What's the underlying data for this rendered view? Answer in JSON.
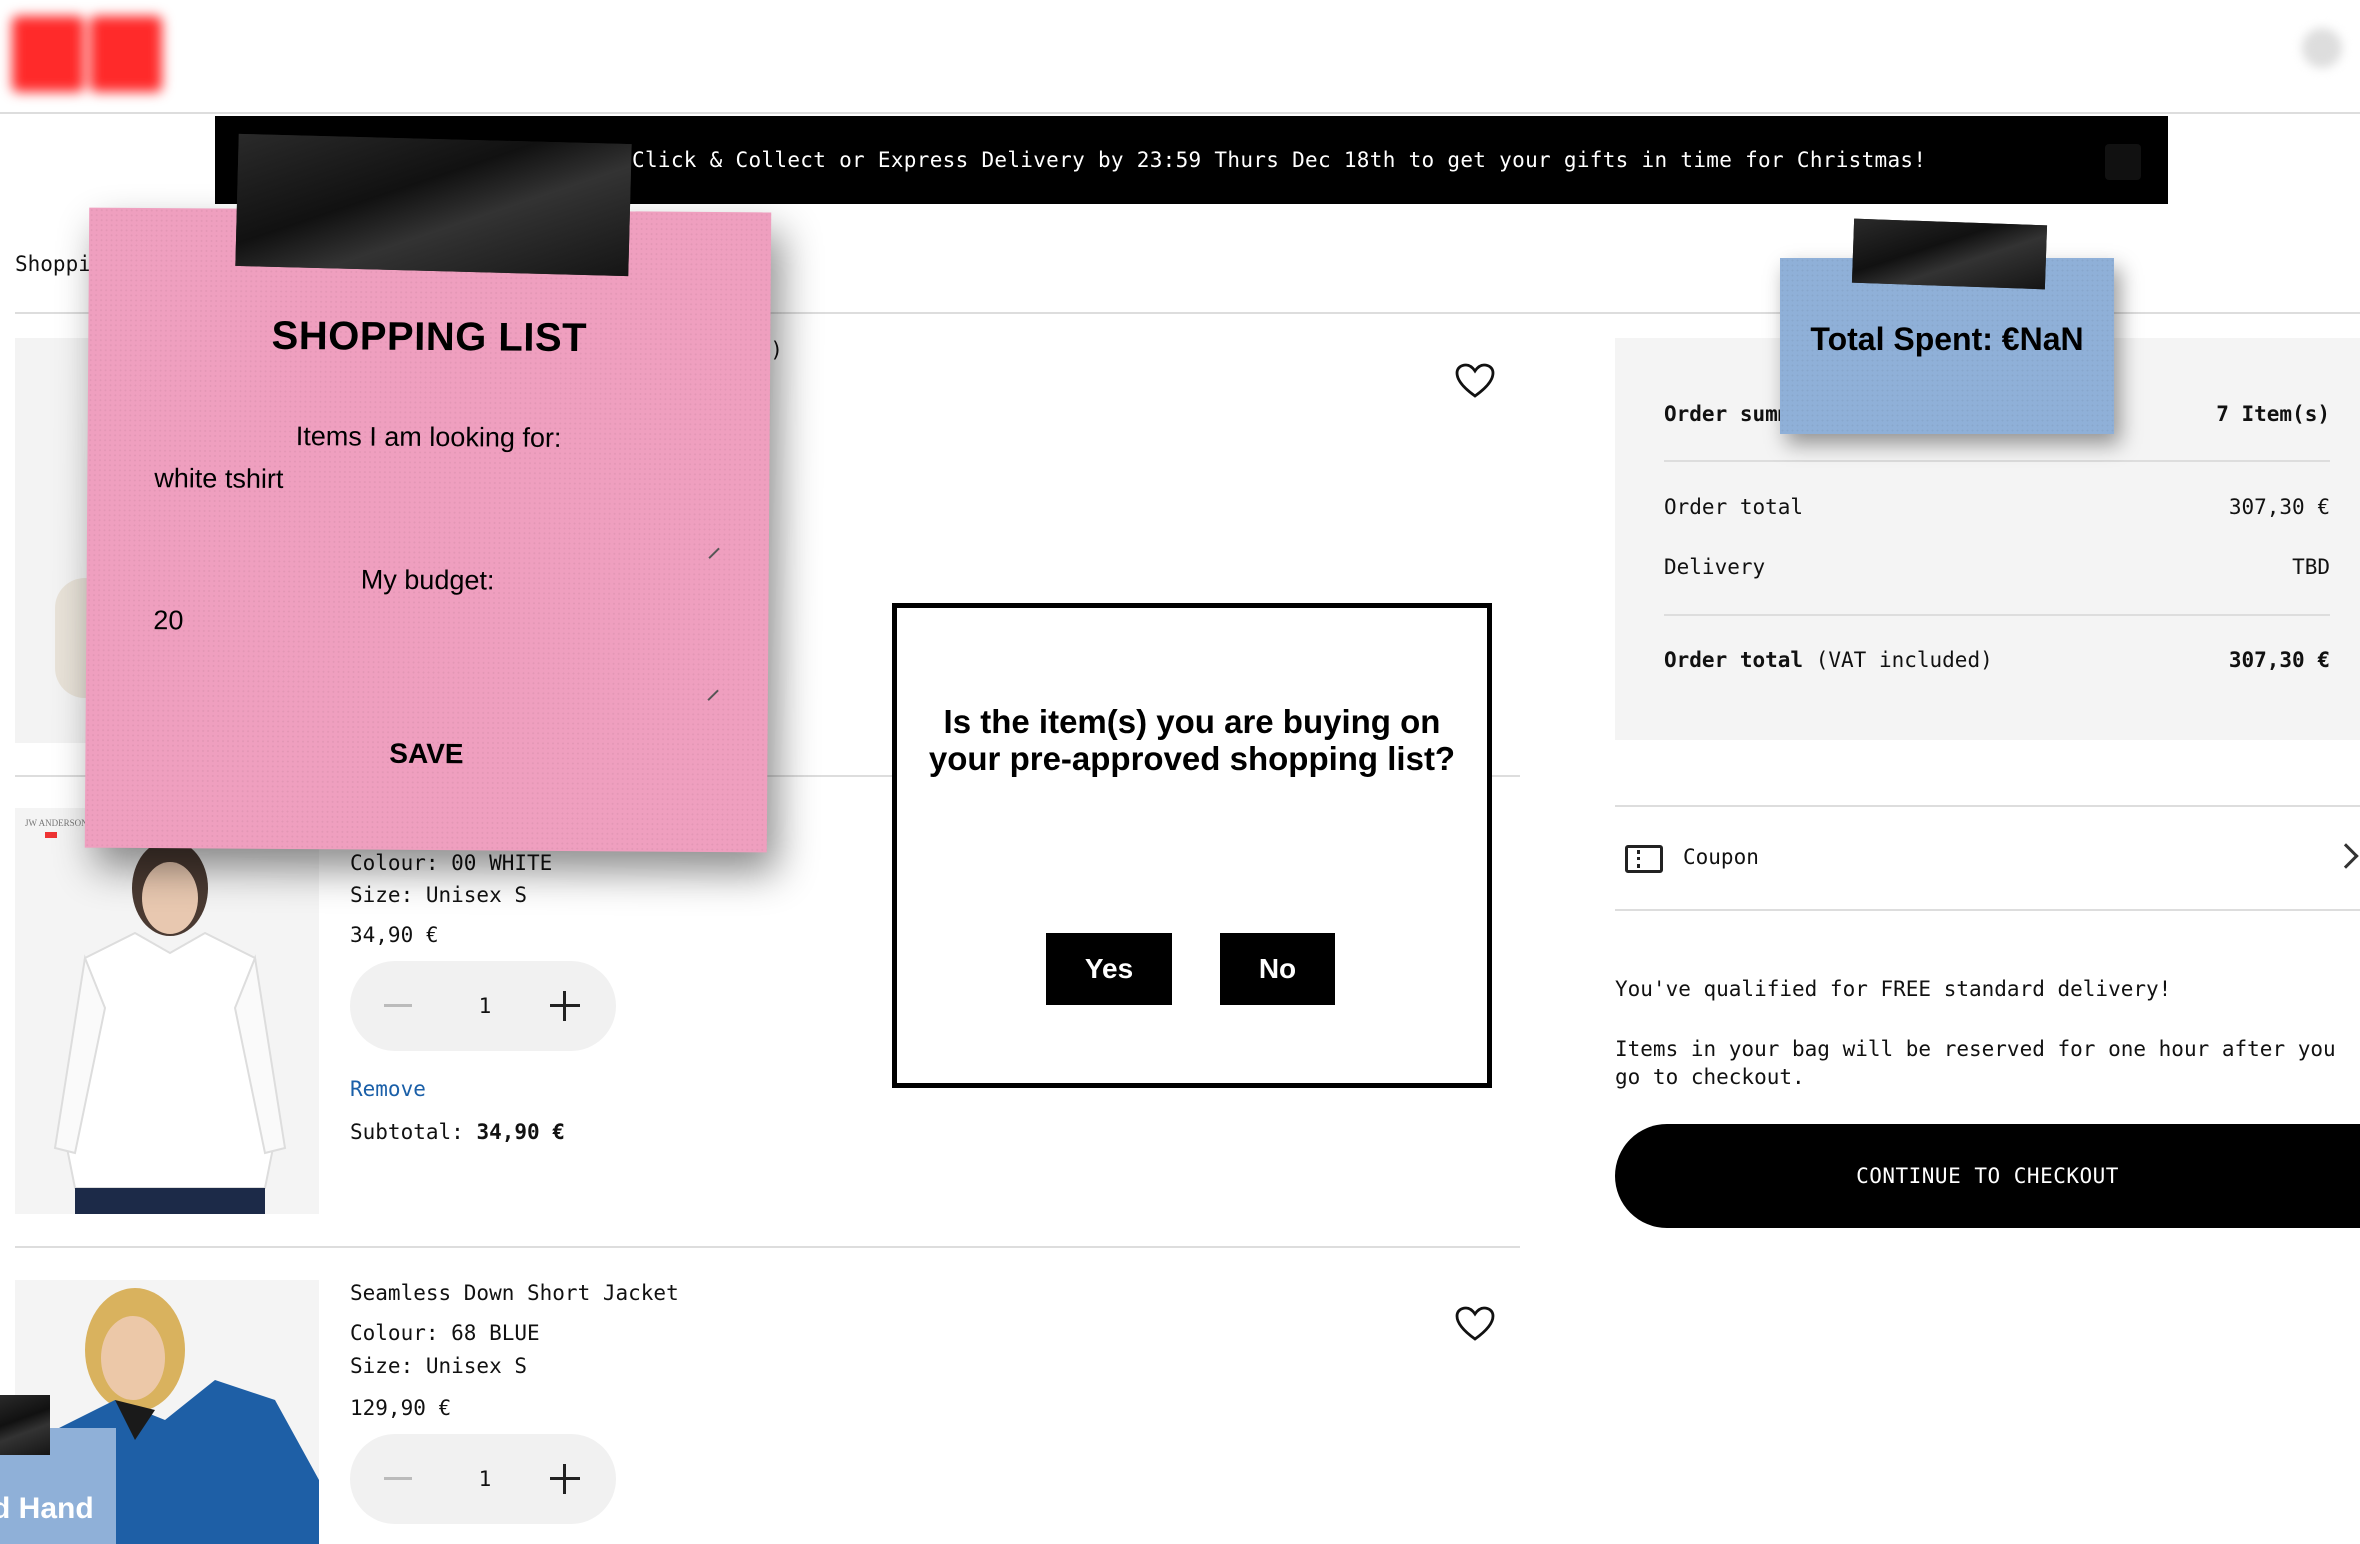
{
  "header": {
    "logo": "brand-logo",
    "icon": "account-icon"
  },
  "banner": {
    "text": "Click & Collect or Express Delivery by 23:59 Thurs Dec 18th to get your gifts in time for Christmas!"
  },
  "breadcrumb": "Shopping",
  "first_product": {
    "partial_text": "er)"
  },
  "products": [
    {
      "colour": "Colour: 00 WHITE",
      "size": "Size: Unisex S",
      "price": "34,90 €",
      "quantity": "1",
      "remove_label": "Remove",
      "subtotal_label": "Subtotal:",
      "subtotal_value": "34,90 €"
    },
    {
      "name": "Seamless Down Short Jacket",
      "colour": "Colour: 68 BLUE",
      "size": "Size: Unisex S",
      "price": "129,90 €",
      "quantity": "1"
    }
  ],
  "summary": {
    "title": "Order summary",
    "title_visible": "Order summ",
    "items_count": "7 Item(s)",
    "order_total_label": "Order total",
    "order_total_value": "307,30 €",
    "delivery_label": "Delivery",
    "delivery_value": "TBD",
    "total_label": "Order total",
    "total_note": "(VAT included)",
    "total_value": "307,30 €"
  },
  "coupon": {
    "label": "Coupon"
  },
  "notes": {
    "free_delivery": "You've qualified for FREE standard delivery!",
    "reserved": "Items in your bag will be reserved for one hour after you go to checkout."
  },
  "checkout_label": "CONTINUE TO CHECKOUT",
  "shopping_list": {
    "title": "SHOPPING LIST",
    "items_label": "Items I am looking for:",
    "items_value": "white tshirt",
    "budget_label": "My budget:",
    "budget_value": "20",
    "save_label": "SAVE"
  },
  "spent_note": {
    "text": "Total Spent: €NaN"
  },
  "hand_note": {
    "text": "d Hand"
  },
  "dialog": {
    "question": "Is the item(s) you are buying on your pre-approved shopping list?",
    "yes_label": "Yes",
    "no_label": "No"
  },
  "colors": {
    "accent_link": "#1a5fa8",
    "note_pink": "#ef9fbf",
    "note_blue": "#8fb0d8"
  }
}
